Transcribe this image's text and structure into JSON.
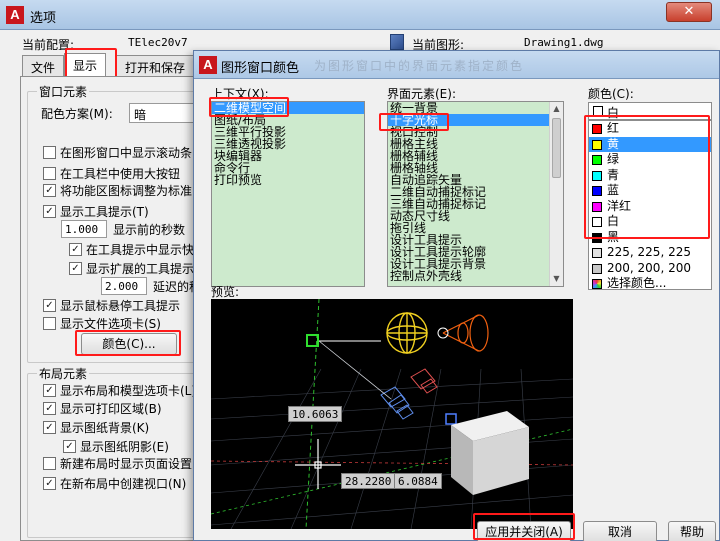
{
  "options_dialog": {
    "title": "选项",
    "close_label": "✕",
    "current_profile_label": "当前配置:",
    "current_profile_value": "TElec20v7",
    "current_drawing_label": "当前图形:",
    "current_drawing_value": "Drawing1.dwg",
    "tabs": [
      "文件",
      "显示",
      "打开和保存"
    ],
    "active_tab": "显示",
    "window_elements": {
      "title": "窗口元素",
      "color_scheme_label": "配色方案(M):",
      "color_scheme_value": "暗",
      "checkboxes": [
        {
          "label": "在图形窗口中显示滚动条",
          "checked": false
        },
        {
          "label": "在工具栏中使用大按钮",
          "checked": false
        },
        {
          "label": "将功能区图标调整为标准",
          "checked": true
        },
        {
          "label": "显示工具提示(T)",
          "checked": true
        }
      ],
      "delay_seconds_value": "1.000",
      "delay_seconds_label": "显示前的秒数",
      "sub_checkboxes": [
        {
          "label": "在工具提示中显示快",
          "checked": true
        },
        {
          "label": "显示扩展的工具提示",
          "checked": true
        }
      ],
      "extended_delay_value": "2.000",
      "extended_delay_label": "延迟的秒数",
      "more_checkboxes": [
        {
          "label": "显示鼠标悬停工具提示",
          "checked": true
        },
        {
          "label": "显示文件选项卡(S)",
          "checked": false
        }
      ],
      "colors_button": "颜色(C)..."
    },
    "layout_elements": {
      "title": "布局元素",
      "checkboxes": [
        {
          "label": "显示布局和模型选项卡(L)",
          "checked": true
        },
        {
          "label": "显示可打印区域(B)",
          "checked": true
        },
        {
          "label": "显示图纸背景(K)",
          "checked": true
        }
      ],
      "sub_checkbox": {
        "label": "显示图纸阴影(E)",
        "checked": true
      },
      "more_checkboxes": [
        {
          "label": "新建布局时显示页面设置",
          "checked": false
        },
        {
          "label": "在新布局中创建视口(N)",
          "checked": true
        }
      ]
    }
  },
  "colors_dialog": {
    "title": "图形窗口颜色",
    "title_ghost": "为图形窗口中的界面元素指定颜色",
    "context_label": "上下文(X):",
    "context_items": [
      "二维模型空间",
      "图纸/布局",
      "三维平行投影",
      "三维透视投影",
      "块编辑器",
      "命令行",
      "打印预览"
    ],
    "context_selected": 0,
    "element_label": "界面元素(E):",
    "element_items": [
      "统一背景",
      "十字光标",
      "视口控制",
      "栅格主线",
      "栅格辅线",
      "栅格轴线",
      "自动追踪矢量",
      "二维自动捕捉标记",
      "三维自动捕捉标记",
      "动态尺寸线",
      "拖引线",
      "设计工具提示",
      "设计工具提示轮廓",
      "设计工具提示背景",
      "控制点外壳线"
    ],
    "element_selected": 1,
    "color_label": "颜色(C):",
    "color_current": {
      "name": "白",
      "hex": "#ffffff"
    },
    "color_options": [
      {
        "name": "红",
        "hex": "#ff0000"
      },
      {
        "name": "黄",
        "hex": "#ffff00"
      },
      {
        "name": "绿",
        "hex": "#00ff00"
      },
      {
        "name": "青",
        "hex": "#00ffff"
      },
      {
        "name": "蓝",
        "hex": "#0000ff"
      },
      {
        "name": "洋红",
        "hex": "#ff00ff"
      },
      {
        "name": "白",
        "hex": "#ffffff"
      },
      {
        "name": "黑",
        "hex": "#000000"
      },
      {
        "name": "225, 225, 225",
        "hex": "#e1e1e1"
      },
      {
        "name": "200, 200, 200",
        "hex": "#c8c8c8"
      },
      {
        "name": "选择颜色...",
        "hex": "palette"
      }
    ],
    "color_selected": 1,
    "preview_label": "预览:",
    "preview_dims": [
      "10.6063",
      "28.2280",
      "6.0884"
    ],
    "buttons": {
      "apply_close": "应用并关闭(A)",
      "cancel": "取消",
      "help": "帮助"
    },
    "accent_highlight": "#ff1a1a",
    "list_bg": "#cdeacd",
    "selection": "#3399ff"
  }
}
